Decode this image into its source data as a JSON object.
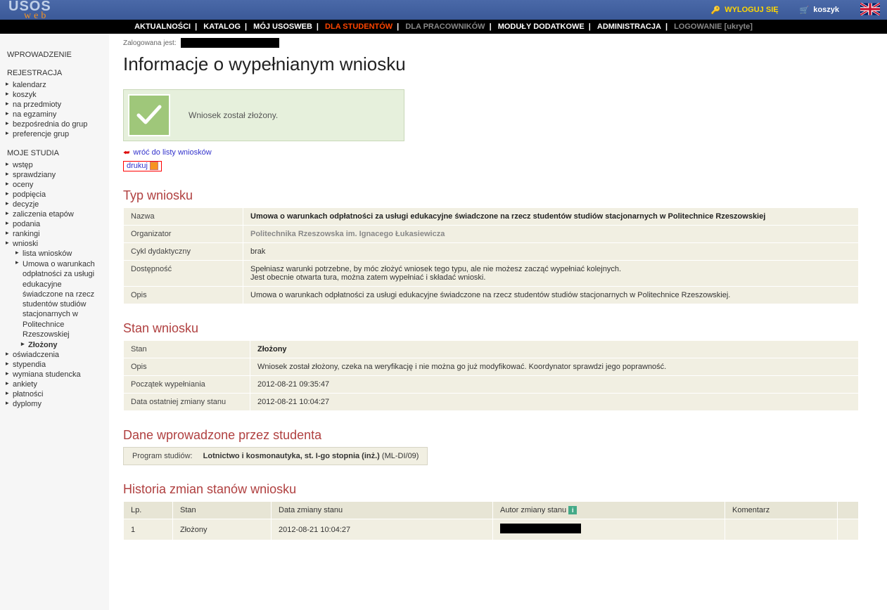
{
  "topbar": {
    "logo_main": "USOS",
    "logo_sub": "web",
    "logout": "WYLOGUJ SIĘ",
    "cart": "koszyk"
  },
  "menubar": {
    "items": [
      "AKTUALNOŚCI",
      "KATALOG",
      "MÓJ USOSWEB",
      "DLA STUDENTÓW",
      "DLA PRACOWNIKÓW",
      "MODUŁY DODATKOWE",
      "ADMINISTRACJA",
      "LOGOWANIE [ukryte]"
    ]
  },
  "sidebar": {
    "sections": [
      {
        "title": "WPROWADZENIE",
        "items": []
      },
      {
        "title": "REJESTRACJA",
        "items": [
          "kalendarz",
          "koszyk",
          "na przedmioty",
          "na egzaminy",
          "bezpośrednia do grup",
          "preferencje grup"
        ]
      },
      {
        "title": "MOJE STUDIA",
        "items": [
          "wstęp",
          "sprawdziany",
          "oceny",
          "podpięcia",
          "decyzje",
          "zaliczenia etapów",
          "podania",
          "rankingi",
          "wnioski"
        ],
        "wnioski_sub": [
          "lista wniosków"
        ],
        "umowa_text": "Umowa o warunkach odpłatności za usługi edukacyjne świadczone na rzecz studentów studiów stacjonarnych w Politechnice Rzeszowskiej",
        "zlozony": "Złożony",
        "after_wnioski": [
          "oświadczenia",
          "stypendia",
          "wymiana studencka",
          "ankiety",
          "płatności",
          "dyplomy"
        ]
      }
    ]
  },
  "main": {
    "loggedin_label": "Zalogowana jest:",
    "title": "Informacje o wypełnianym wniosku",
    "success": "Wniosek został złożony.",
    "link_back": "wróć do listy wniosków",
    "link_print": "drukuj",
    "section_typ": "Typ wniosku",
    "typ_rows": [
      {
        "label": "Nazwa",
        "value": "Umowa o warunkach odpłatności za usługi edukacyjne świadczone na rzecz studentów studiów stacjonarnych w Politechnice Rzeszowskiej",
        "bold": true
      },
      {
        "label": "Organizator",
        "value": "Politechnika Rzeszowska im. Ignacego Łukasiewicza",
        "gray": true
      },
      {
        "label": "Cykl dydaktyczny",
        "value": "brak"
      },
      {
        "label": "Dostępność",
        "value": "Spełniasz warunki potrzebne, by móc złożyć wniosek tego typu, ale nie możesz zacząć wypełniać kolejnych.\nJest obecnie otwarta tura, można zatem wypełniać i składać wnioski."
      },
      {
        "label": "Opis",
        "value": "Umowa o warunkach odpłatności za usługi edukacyjne świadczone na rzecz studentów studiów stacjonarnych w Politechnice Rzeszowskiej."
      }
    ],
    "section_stan": "Stan wniosku",
    "stan_rows": [
      {
        "label": "Stan",
        "value": "Złożony",
        "bold": true
      },
      {
        "label": "Opis",
        "value": "Wniosek został złożony, czeka na weryfikację i nie można go już modyfikować. Koordynator sprawdzi jego poprawność."
      },
      {
        "label": "Początek wypełniania",
        "value": "2012-08-21 09:35:47"
      },
      {
        "label": "Data ostatniej zmiany stanu",
        "value": "2012-08-21 10:04:27"
      }
    ],
    "section_dane": "Dane wprowadzone przez studenta",
    "program_label": "Program studiów:",
    "program_value": "Lotnictwo i kosmonautyka, st. I-go stopnia (inż.)",
    "program_code": "(ML-DI/09)",
    "section_historia": "Historia zmian stanów wniosku",
    "history_headers": [
      "Lp.",
      "Stan",
      "Data zmiany stanu",
      "Autor zmiany stanu",
      "Komentarz",
      ""
    ],
    "history_rows": [
      {
        "lp": "1",
        "stan": "Złożony",
        "data": "2012-08-21 10:04:27",
        "komentarz": ""
      }
    ]
  }
}
